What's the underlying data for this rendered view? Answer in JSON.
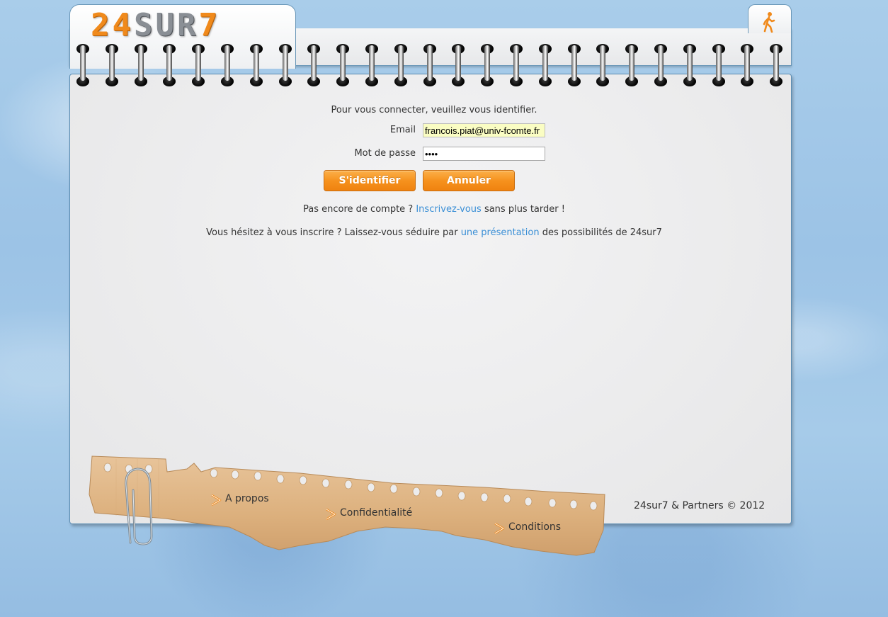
{
  "header": {
    "logo_num": "24",
    "logo_txt": "SUR",
    "logo_seven": "7",
    "logout_icon": "walking-person-icon"
  },
  "login": {
    "prompt": "Pour vous connecter, veuillez vous identifier.",
    "email_label": "Email",
    "email_value": "francois.piat@univ-fcomte.fr",
    "password_label": "Mot de passe",
    "password_value": "••••",
    "submit_label": "S'identifier",
    "cancel_label": "Annuler"
  },
  "signup": {
    "before": "Pas encore de compte ? ",
    "link": "Inscrivez-vous",
    "after": " sans plus tarder !"
  },
  "presentation": {
    "before": "Vous hésitez à vous inscrire ? Laissez-vous séduire par ",
    "link": "une présentation",
    "after": " des possibilités de 24sur7"
  },
  "footer": {
    "links": [
      "A propos",
      "Confidentialité",
      "Conditions"
    ],
    "copyright": "24sur7 & Partners © 2012"
  },
  "colors": {
    "accent_orange": "#f6921e",
    "link_blue": "#3a8fd6",
    "background_blue": "#a9cdea"
  }
}
